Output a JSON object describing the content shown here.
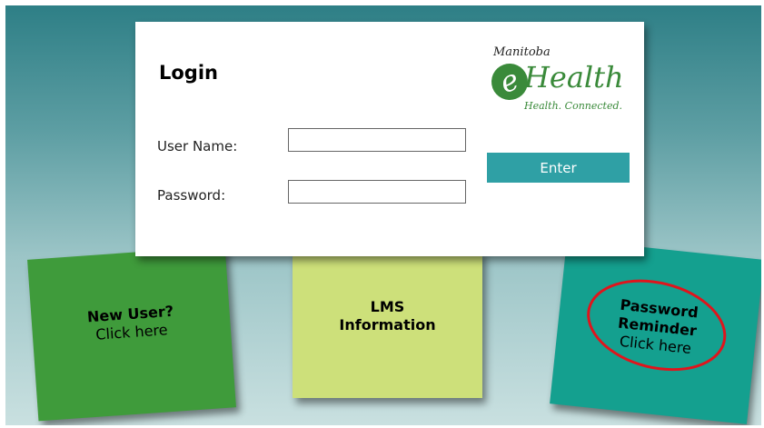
{
  "login": {
    "title": "Login",
    "username_label": "User Name:",
    "username_value": "",
    "password_label": "Password:",
    "password_value": "",
    "enter_label": "Enter"
  },
  "logo": {
    "province": "Manitoba",
    "brand_letter": "e",
    "brand_word": "Health",
    "tagline": "Health. Connected."
  },
  "cards": {
    "new_user": {
      "line1": "New User?",
      "line2": "Click here",
      "color": "#3f9b3b"
    },
    "lms": {
      "line1": "LMS",
      "line2": "Information",
      "color": "#cde07a"
    },
    "password_reminder": {
      "line1": "Password",
      "line2": "Reminder",
      "line3": "Click here",
      "color": "#14a08f"
    }
  },
  "colors": {
    "accent": "#2fa0a5",
    "brand_green": "#3a8a3a",
    "highlight_ring": "#e0141c"
  }
}
